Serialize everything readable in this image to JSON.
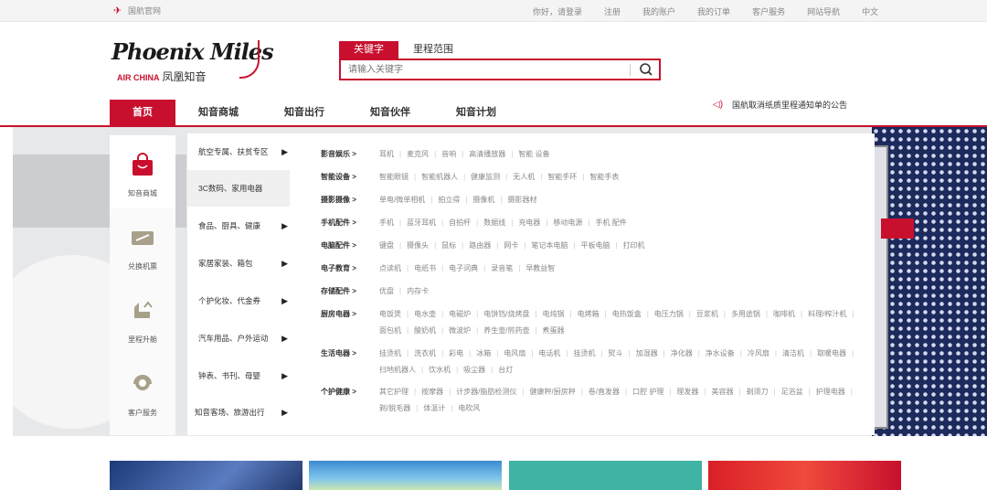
{
  "topbar": {
    "home": "国航官网",
    "links": [
      "你好，请登录",
      "注册",
      "我的账户",
      "我的订单",
      "客户服务",
      "网站导航",
      "中文"
    ]
  },
  "logo": {
    "script": "Phoenix Miles",
    "airline": "AIR CHINA",
    "name": "凤凰知音"
  },
  "search": {
    "tabs": [
      "关键字",
      "里程范围"
    ],
    "placeholder": "请输入关键字"
  },
  "nav": {
    "items": [
      "首页",
      "知音商城",
      "知音出行",
      "知音伙伴",
      "知音计划"
    ],
    "notice": "国航取消纸质里程通知单的公告"
  },
  "left_icons": [
    "知音商城",
    "兑换机票",
    "里程升舱",
    "客户服务"
  ],
  "categories": [
    "航空专属、扶贫专区",
    "3C数码、家用电器",
    "食品、厨具、健康",
    "家居家装、箱包",
    "个护化妆、代金券",
    "汽车用品、户外运动",
    "钟表、书刊、母婴",
    "知音客场、旅游出行"
  ],
  "subcategories": [
    {
      "head": "影音娱乐 >",
      "items": [
        "耳机",
        "麦克风",
        "音响",
        "高清播放器",
        "智能 设备"
      ]
    },
    {
      "head": "智能设备 >",
      "items": [
        "智能眼镜",
        "智能机器人",
        "健康监测",
        "无人机",
        "智能手环",
        "智能手表"
      ]
    },
    {
      "head": "摄影摄像 >",
      "items": [
        "单电/微单相机",
        "拍立得",
        "摄像机",
        "摄影器材"
      ]
    },
    {
      "head": "手机配件 >",
      "items": [
        "手机",
        "蓝牙耳机",
        "自拍杆",
        "数据线",
        "充电器",
        "移动电源",
        "手机 配件"
      ]
    },
    {
      "head": "电脑配件 >",
      "items": [
        "键盘",
        "摄像头",
        "鼠标",
        "路由器",
        "网卡",
        "笔记本电脑",
        "平板电脑",
        "打印机"
      ]
    },
    {
      "head": "电子教育 >",
      "items": [
        "点读机",
        "电纸书",
        "电子词典",
        "录音笔",
        "早教益智"
      ]
    },
    {
      "head": "存储配件 >",
      "items": [
        "优盘",
        "内存卡"
      ]
    },
    {
      "head": "厨房电器 >",
      "items": [
        "电饭煲",
        "电水壶",
        "电磁炉",
        "电饼铛/烧烤盘",
        "电炖锅",
        "电烤箱",
        "电热饭盒",
        "电压力锅",
        "豆浆机",
        "多用途锅",
        "咖啡机",
        "料理/榨汁机",
        "面包机",
        "酸奶机",
        "微波炉",
        "养生壶/煎药壶",
        "煮蛋器"
      ]
    },
    {
      "head": "生活电器 >",
      "items": [
        "挂烫机",
        "洗衣机",
        "彩电",
        "冰箱",
        "电风扇",
        "电话机",
        "挂烫机",
        "熨斗",
        "加湿器",
        "净化器",
        "净水设备",
        "冷风扇",
        "清洁机",
        "取暖电器",
        "扫地机器人",
        "饮水机",
        "吸尘器",
        "台灯"
      ]
    },
    {
      "head": "个护健康 >",
      "items": [
        "其它护理",
        "按摩器",
        "计步器/脂肪检测仪",
        "健康秤/厨房秤",
        "卷/直发器",
        "口腔 护理",
        "理发器",
        "美容器",
        "剃须刀",
        "足浴盆",
        "护理电器",
        "剃/脱毛器",
        "体温计",
        "电吹风"
      ]
    }
  ],
  "colors": {
    "brand": "#c8102e"
  }
}
